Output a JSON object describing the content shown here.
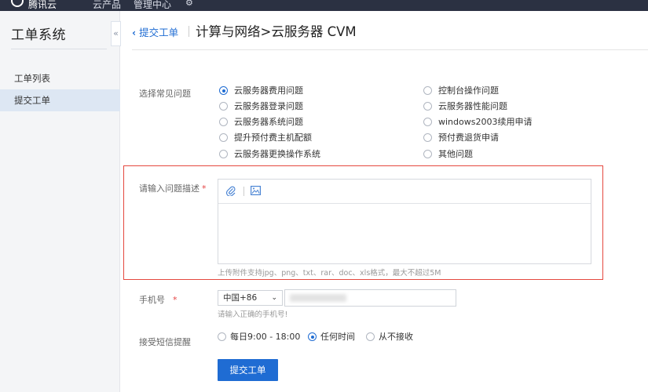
{
  "topbar": {
    "logo_text": "腾讯云",
    "nav": [
      "云产品",
      "管理中心"
    ]
  },
  "sidebar": {
    "title": "工单系统",
    "collapse": "«",
    "items": [
      {
        "label": "工单列表",
        "active": false
      },
      {
        "label": "提交工单",
        "active": true
      }
    ]
  },
  "header": {
    "back": "提交工单",
    "breadcrumb": "计算与网络>云服务器 CVM"
  },
  "form": {
    "faq_label": "选择常见问题",
    "faq_options": [
      {
        "label": "云服务器费用问题",
        "checked": true
      },
      {
        "label": "控制台操作问题",
        "checked": false
      },
      {
        "label": "云服务器登录问题",
        "checked": false
      },
      {
        "label": "云服务器性能问题",
        "checked": false
      },
      {
        "label": "云服务器系统问题",
        "checked": false
      },
      {
        "label": "windows2003续用申请",
        "checked": false
      },
      {
        "label": "提升预付费主机配额",
        "checked": false
      },
      {
        "label": "预付费退货申请",
        "checked": false
      },
      {
        "label": "云服务器更换操作系统",
        "checked": false
      },
      {
        "label": "其他问题",
        "checked": false
      }
    ],
    "desc_label": "请输入问题描述",
    "required_mark": "*",
    "desc_value": "",
    "upload_hint": "上传附件支持jpg、png、txt、rar、doc、xls格式，最大不超过5M",
    "phone_label": "手机号",
    "country_code": "中国+86",
    "phone_value": "",
    "phone_hint": "请输入正确的手机号!",
    "sms_label": "接受短信提醒",
    "sms_options": [
      {
        "label": "每日9:00 - 18:00",
        "checked": false
      },
      {
        "label": "任何时间",
        "checked": true
      },
      {
        "label": "从不接收",
        "checked": false
      }
    ],
    "submit_label": "提交工单"
  },
  "colors": {
    "accent": "#1f6cd3",
    "highlight": "#e5483f",
    "topbar": "#2b3142"
  },
  "icons": {
    "attach": "paperclip-icon",
    "image": "image-icon"
  }
}
